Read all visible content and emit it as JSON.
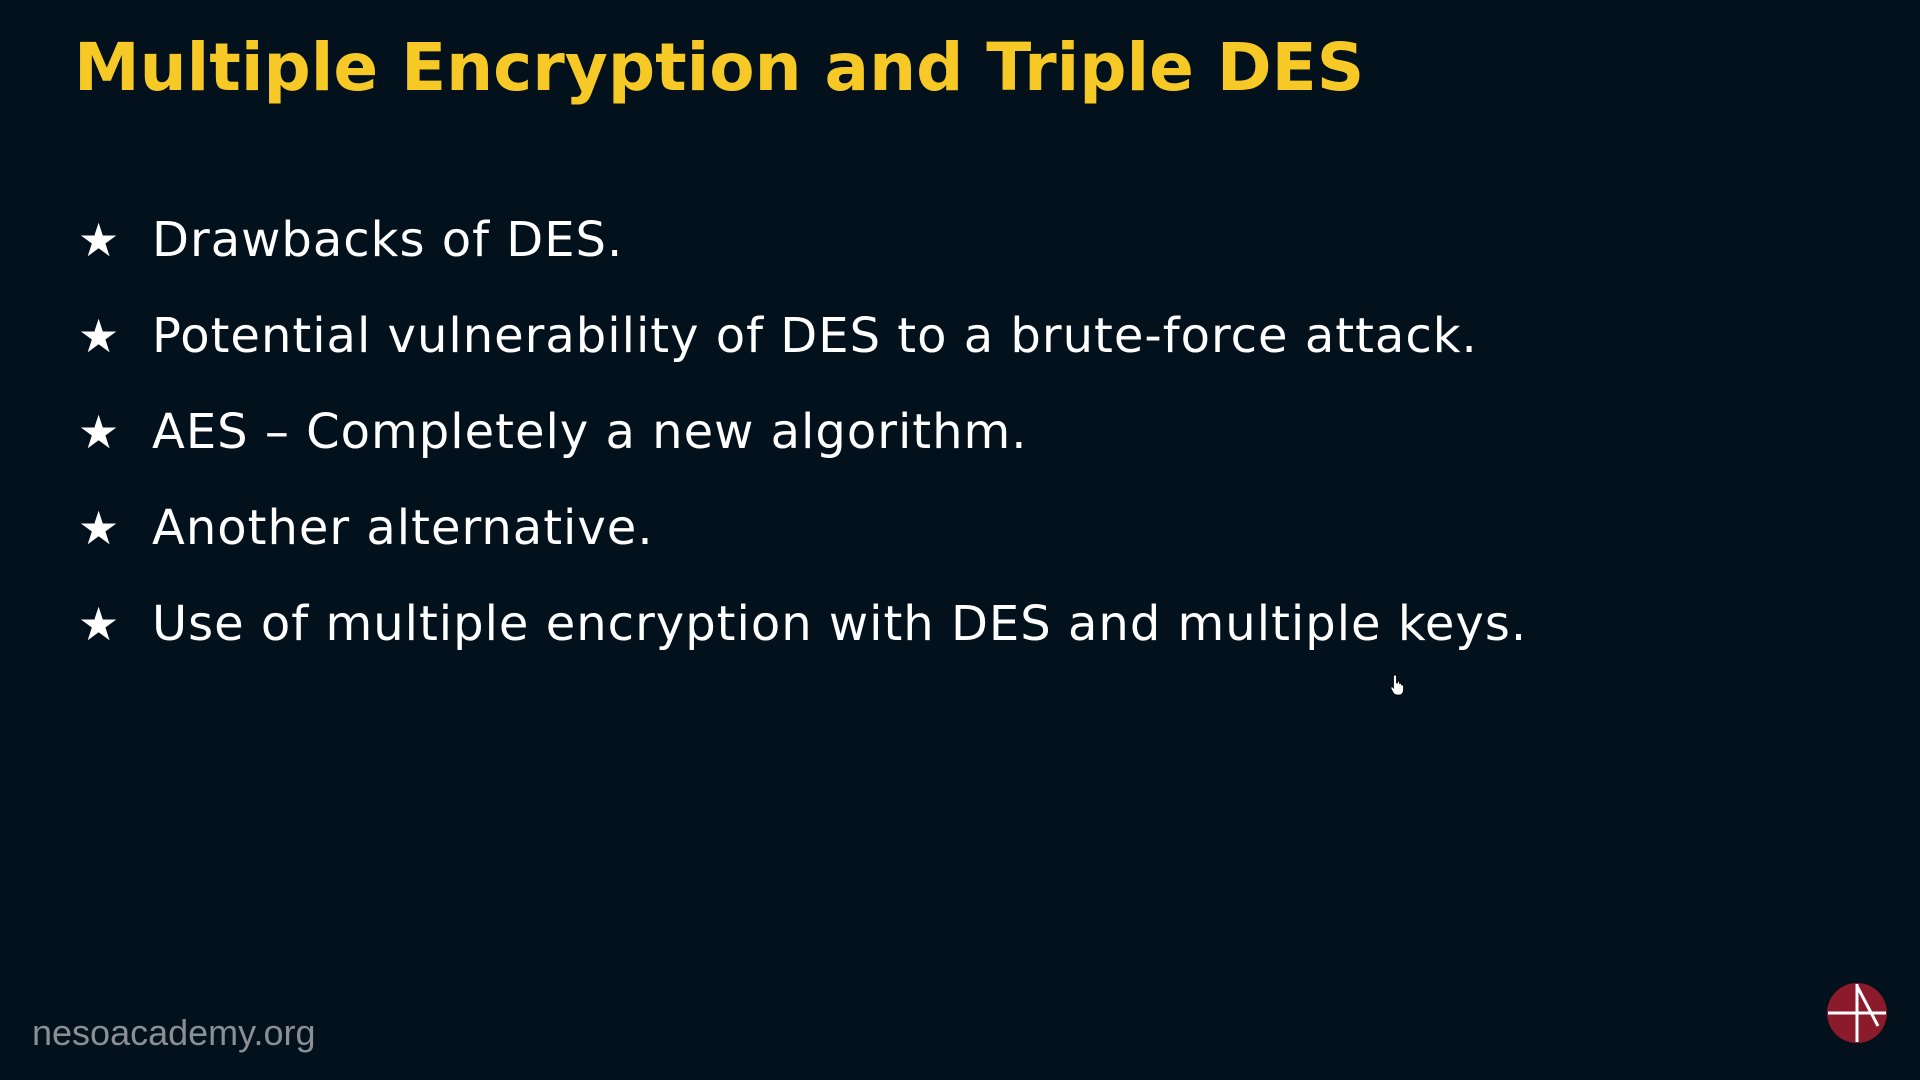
{
  "slide": {
    "title": "Multiple Encryption and Triple DES",
    "bullets": [
      {
        "icon": "star-icon",
        "text": "Drawbacks of DES."
      },
      {
        "icon": "star-icon",
        "text": "Potential vulnerability of DES to a brute-force attack."
      },
      {
        "icon": "star-icon",
        "text": "AES – Completely a new algorithm."
      },
      {
        "icon": "star-icon",
        "text": "Another alternative."
      },
      {
        "icon": "star-icon",
        "text": "Use of multiple encryption with DES and multiple keys."
      }
    ]
  },
  "watermark": {
    "text": "nesoacademy.org"
  },
  "colors": {
    "background": "#02111b",
    "title": "#f7c926",
    "text": "#ffffff",
    "watermark": "#8a8f95",
    "logo": "#8b1a2b"
  },
  "icons": {
    "cursor": "hand-pointer-icon",
    "logo": "neso-academy-logo-icon"
  }
}
